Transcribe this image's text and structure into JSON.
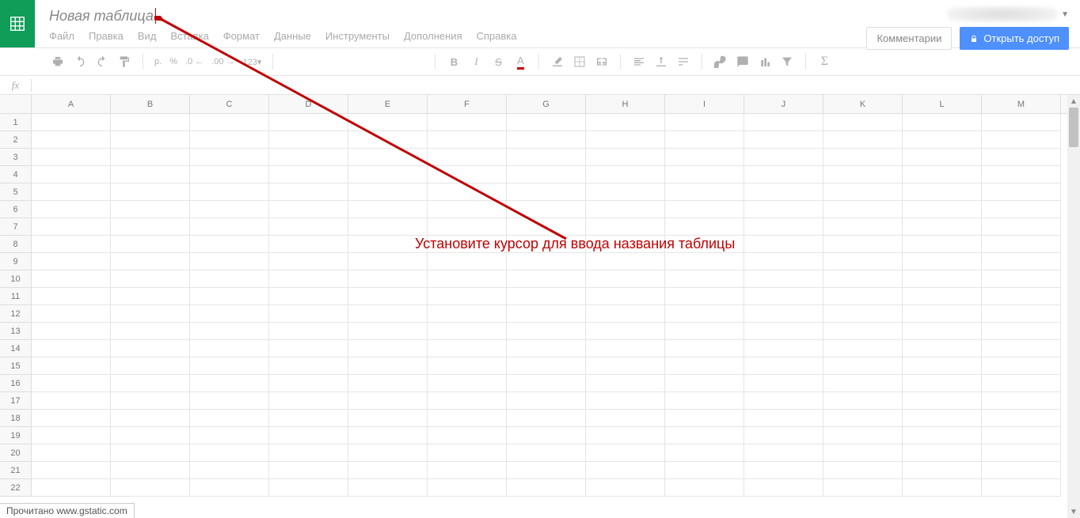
{
  "header": {
    "title": "Новая таблица",
    "comments_btn": "Комментарии",
    "share_btn": "Открыть доступ"
  },
  "menu": {
    "items": [
      "Файл",
      "Правка",
      "Вид",
      "Вставка",
      "Формат",
      "Данные",
      "Инструменты",
      "Дополнения",
      "Справка"
    ]
  },
  "toolbar": {
    "currency": "р.",
    "percent": "%",
    "dec_dec": ".0",
    "dec_inc": ".00",
    "bold": "B",
    "italic": "I",
    "strike": "S",
    "textcolor": "A"
  },
  "formula": {
    "fx": "fx",
    "value": ""
  },
  "grid": {
    "columns": [
      "A",
      "B",
      "C",
      "D",
      "E",
      "F",
      "G",
      "H",
      "I",
      "J",
      "K",
      "L",
      "M"
    ],
    "row_count": 22
  },
  "annotation": {
    "text": "Установите курсор для ввода названия таблицы"
  },
  "status": {
    "text": "Прочитано www.gstatic.com"
  }
}
